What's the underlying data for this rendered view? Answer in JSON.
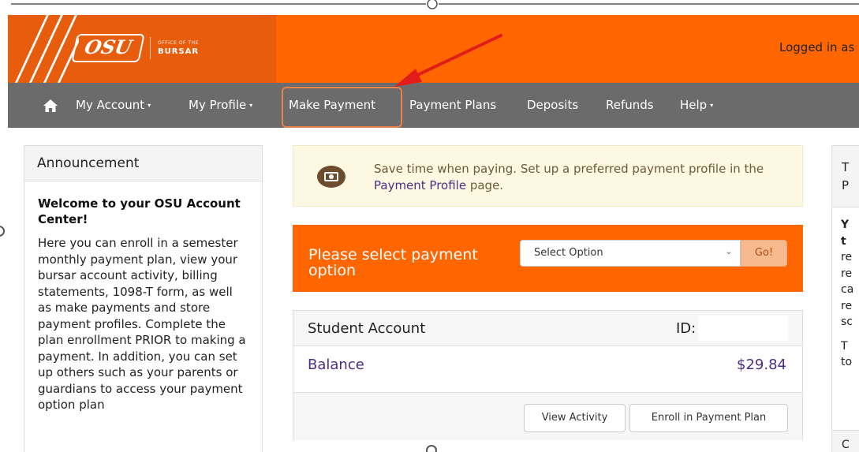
{
  "header": {
    "logo_text": "OSU",
    "logo_sub_small": "OFFICE OF THE",
    "logo_sub_big": "BURSAR",
    "logged_in": "Logged in as"
  },
  "nav": {
    "home_icon": "home-icon",
    "items": [
      {
        "label": "My Account",
        "dropdown": true
      },
      {
        "label": "My Profile",
        "dropdown": true
      },
      {
        "label": "Make Payment",
        "dropdown": false
      },
      {
        "label": "Payment Plans",
        "dropdown": false
      },
      {
        "label": "Deposits",
        "dropdown": false
      },
      {
        "label": "Refunds",
        "dropdown": false
      },
      {
        "label": "Help",
        "dropdown": true
      }
    ],
    "caret": "▾"
  },
  "announcement": {
    "header": "Announcement",
    "title": "Welcome to your OSU Account Center!",
    "body": "Here you can enroll in a semester monthly payment plan, view your bursar account activity, billing statements, 1098-T form, as well as make payments and store payment profiles. Complete the plan enrollment PRIOR to making a payment. In addition, you can set up others such as your parents or guardians to access your payment option plan"
  },
  "notice": {
    "text_before": "Save time when paying. Set up a preferred payment profile in the ",
    "link": "Payment Profile",
    "text_after": " page."
  },
  "payment_bar": {
    "label": "Please select payment option",
    "select_value": "Select Option",
    "go_label": "Go!"
  },
  "account": {
    "title": "Student Account",
    "id_label": "ID:",
    "balance_label": "Balance",
    "balance_value": "$29.84",
    "view_activity": "View Activity",
    "enroll_plan": "Enroll in Payment Plan"
  },
  "right_card": {
    "head_line1": "T",
    "head_line2": "P",
    "body_lines": [
      "Y",
      "t",
      "re",
      "re",
      "ca",
      "re",
      "sc"
    ],
    "body_lines2": [
      "T",
      "to"
    ],
    "bottom": "C"
  },
  "colors": {
    "brand_orange": "#ff6600",
    "nav_gray": "#6b6b6b",
    "link_purple": "#4b2e83",
    "arrow_red": "#e21b1b"
  }
}
